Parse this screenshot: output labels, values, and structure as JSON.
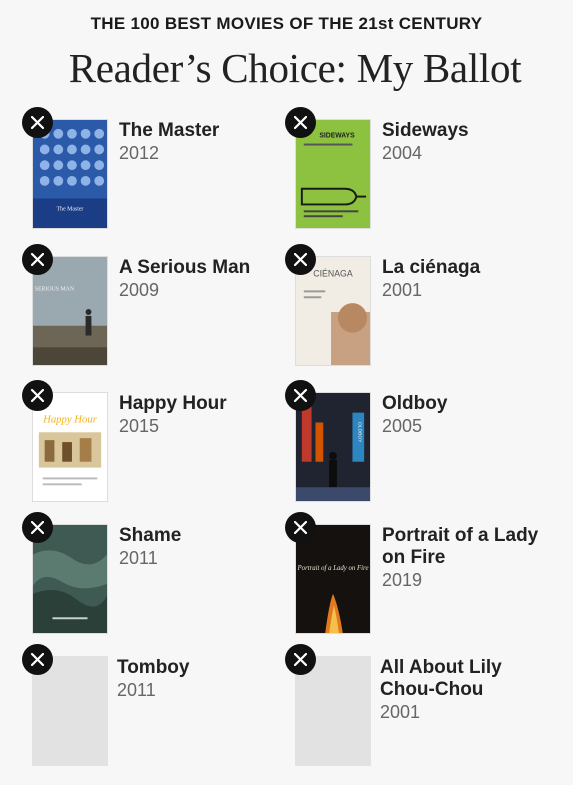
{
  "header": {
    "kicker": "THE 100 BEST MOVIES OF THE 21st CENTURY",
    "title": "Reader’s Choice: My Ballot"
  },
  "remove_icon": "close-icon",
  "films": [
    {
      "title": "The Master",
      "year": "2012",
      "poster_text": "The Master"
    },
    {
      "title": "Sideways",
      "year": "2004",
      "poster_text": "SIDEWAYS"
    },
    {
      "title": "A Serious Man",
      "year": "2009",
      "poster_text": "SERIOUS MAN"
    },
    {
      "title": "La ciénaga",
      "year": "2001",
      "poster_text": "CIÉNAGA"
    },
    {
      "title": "Happy Hour",
      "year": "2015",
      "poster_text": "Happy Hour"
    },
    {
      "title": "Oldboy",
      "year": "2005",
      "poster_text": "OLDBOY"
    },
    {
      "title": "Shame",
      "year": "2011",
      "poster_text": ""
    },
    {
      "title": "Portrait of a Lady on Fire",
      "year": "2019",
      "poster_text": "Portrait of a Lady on Fire"
    },
    {
      "title": "Tomboy",
      "year": "2011",
      "poster_text": ""
    },
    {
      "title": "All About Lily Chou-Chou",
      "year": "2001",
      "poster_text": ""
    }
  ]
}
